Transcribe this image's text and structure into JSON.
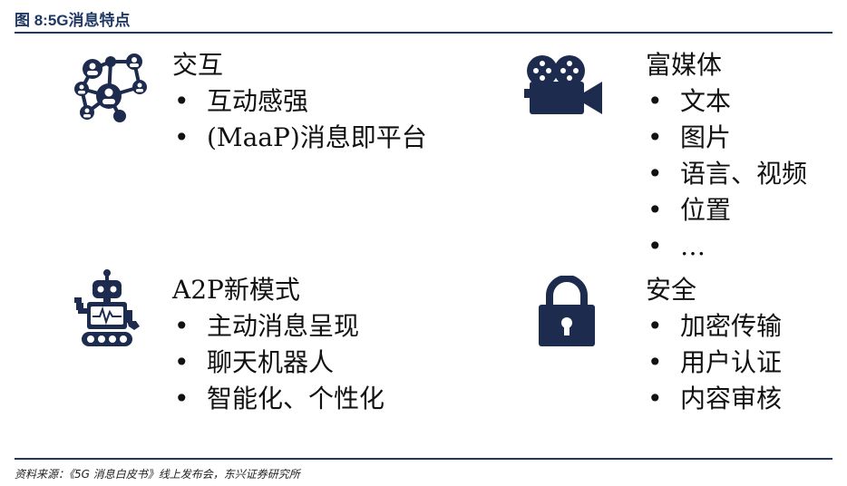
{
  "figure_title": "图 8:5G消息特点",
  "source": "资料来源：《5G 消息白皮书》线上发布会，东兴证券研究所",
  "colors": {
    "accent": "#1f3864",
    "icon": "#1c2b4e"
  },
  "quadrants": [
    {
      "icon": "network-people-icon",
      "title": "交互",
      "items": [
        "互动感强",
        "(MaaP)消息即平台"
      ]
    },
    {
      "icon": "video-camera-icon",
      "title": "富媒体",
      "items": [
        "文本",
        "图片",
        "语言、视频",
        "位置",
        "…"
      ]
    },
    {
      "icon": "robot-icon",
      "title": "A2P新模式",
      "items": [
        "主动消息呈现",
        "聊天机器人",
        "智能化、个性化"
      ]
    },
    {
      "icon": "padlock-icon",
      "title": "安全",
      "items": [
        "加密传输",
        "用户认证",
        "内容审核"
      ]
    }
  ]
}
